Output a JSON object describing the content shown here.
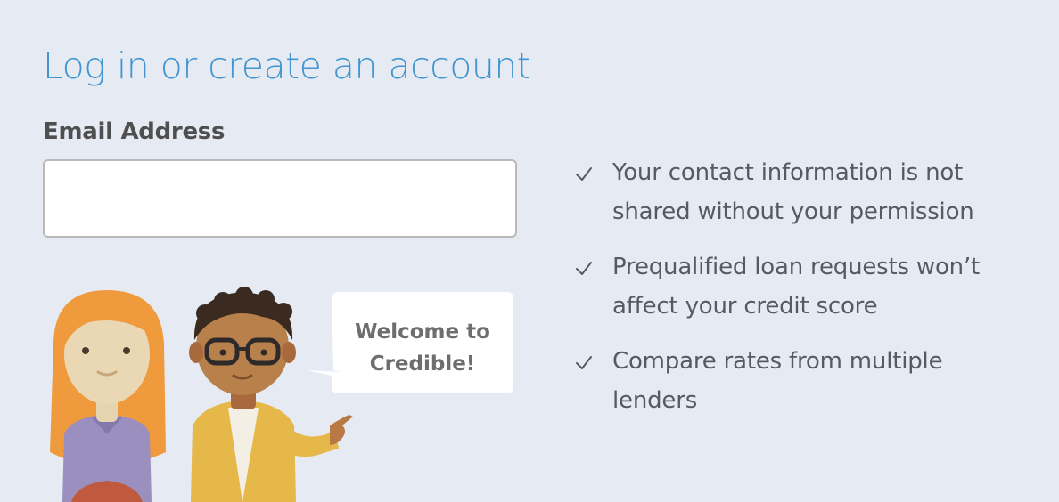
{
  "login": {
    "title": "Log in or create an account",
    "email_label": "Email Address",
    "email_value": ""
  },
  "illustration": {
    "speech_bubble_line1": "Welcome to",
    "speech_bubble_line2": "Credible!"
  },
  "benefits": {
    "items": [
      {
        "icon": "check-icon",
        "text": "Your contact information is not shared without your permission"
      },
      {
        "icon": "check-icon",
        "text": "Prequalified loan requests won’t affect your credit score"
      },
      {
        "icon": "check-icon",
        "text": "Compare rates from multiple lenders"
      }
    ]
  },
  "colors": {
    "background": "#e5eaf3",
    "title_blue": "#4196cf",
    "text_gray": "#555b63"
  }
}
